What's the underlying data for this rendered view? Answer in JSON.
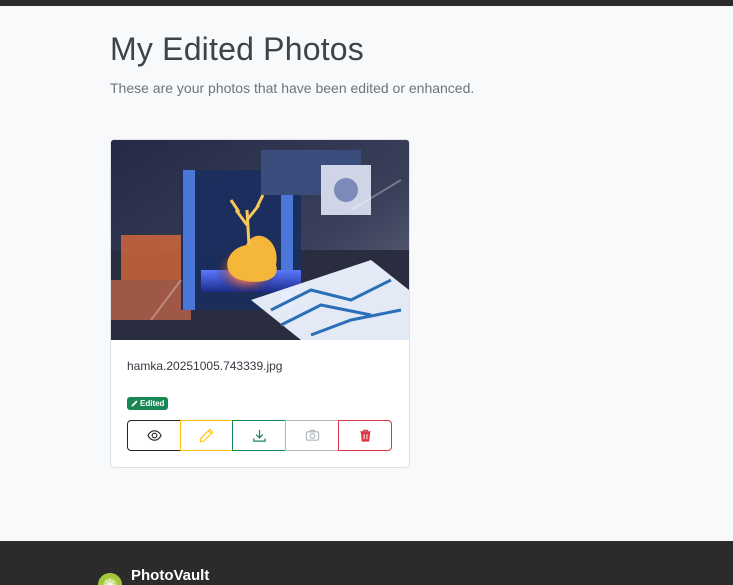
{
  "page": {
    "title": "My Edited Photos",
    "subtitle": "These are your photos that have been edited or enhanced."
  },
  "photos": [
    {
      "filename": "hamka.20251005.743339.jpg",
      "badge": "Edited",
      "image_description_icon": "3d-printer-photo",
      "actions": [
        {
          "name": "view",
          "icon": "eye-icon",
          "color": "#212529"
        },
        {
          "name": "edit",
          "icon": "pencil-icon",
          "color": "#ffc107"
        },
        {
          "name": "download",
          "icon": "download-icon",
          "color": "#198754"
        },
        {
          "name": "camera",
          "icon": "camera-icon",
          "color": "#adb5bd"
        },
        {
          "name": "delete",
          "icon": "trash-icon",
          "color": "#dc3545"
        }
      ]
    }
  ],
  "footer": {
    "brand": "PhotoVault"
  },
  "colors": {
    "topbar": "#2b2b2b",
    "footer": "#2b2b2b",
    "badge": "#198754",
    "background": "#f8f9fb"
  }
}
